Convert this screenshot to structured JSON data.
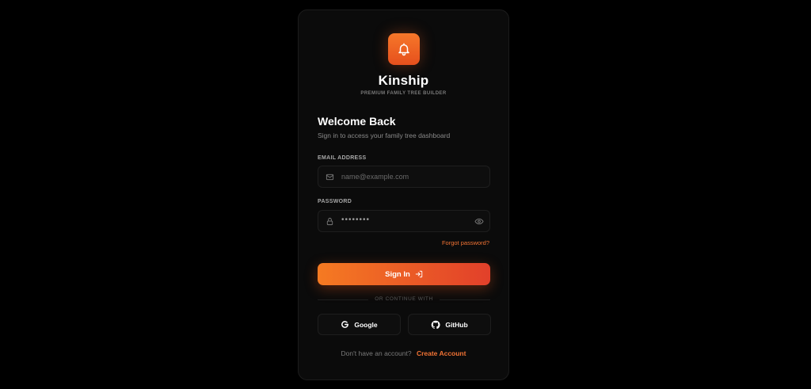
{
  "brand": {
    "name": "Kinship",
    "tagline": "PREMIUM FAMILY TREE BUILDER",
    "logo_icon": "bell-icon",
    "accent_color": "#f27334"
  },
  "heading": {
    "title": "Welcome Back",
    "subtitle": "Sign in to access your family tree dashboard"
  },
  "form": {
    "email": {
      "label": "EMAIL ADDRESS",
      "placeholder": "name@example.com",
      "value": "",
      "icon": "mail-icon"
    },
    "password": {
      "label": "PASSWORD",
      "masked_value": "••••••••",
      "icon": "lock-icon",
      "toggle_icon": "eye-icon"
    },
    "forgot_link": "Forgot password?",
    "submit_label": "Sign In",
    "submit_icon": "login-arrow-icon"
  },
  "divider_text": "OR CONTINUE WITH",
  "social": [
    {
      "label": "Google",
      "icon": "google-icon"
    },
    {
      "label": "GitHub",
      "icon": "github-icon"
    }
  ],
  "footer": {
    "question": "Don't have an account?",
    "link": "Create Account"
  }
}
